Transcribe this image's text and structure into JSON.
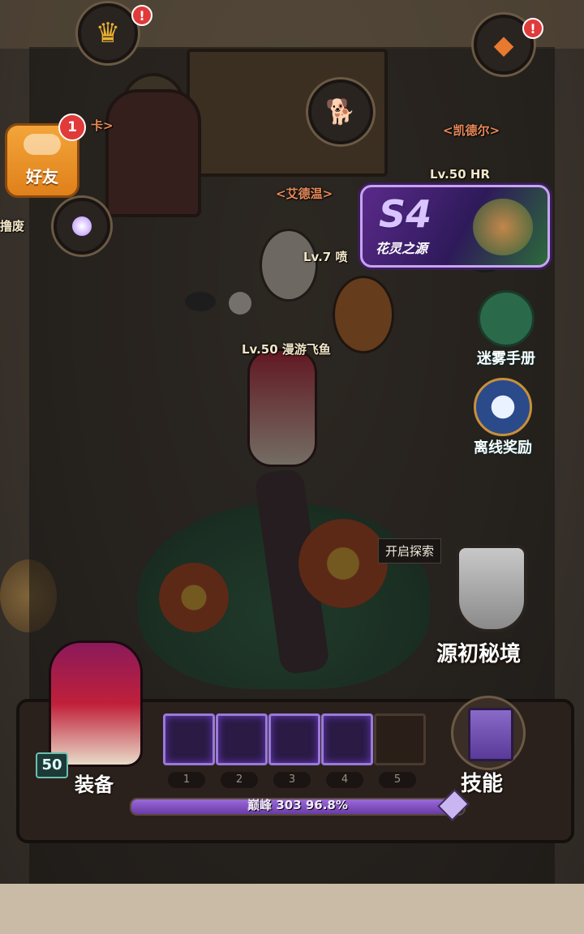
{
  "friends": {
    "label": "好友",
    "badge": "1"
  },
  "npcs": {
    "aiedewen": "<艾德温>",
    "kaideer": "<凯德尔>",
    "left_partial": "卡>",
    "left_partial2": "撸废"
  },
  "players": {
    "lv50_hr": "Lv.50 HR",
    "lv7": "Lv.7 喷",
    "lv50_main": "Lv.50 漫游飞鱼"
  },
  "event": {
    "season": "S4",
    "title": "花灵之源"
  },
  "side_menu": {
    "fog_manual": "迷雾手册",
    "offline_reward": "离线奖励"
  },
  "explore": {
    "tip": "开启探索",
    "realm_label": "源初秘境"
  },
  "bottom": {
    "level": "50",
    "equip_label": "装备",
    "skill_label": "技能",
    "slots": [
      "1",
      "2",
      "3",
      "4",
      "5"
    ],
    "progress_text": "巅峰 303  96.8%",
    "progress_percent": 96.8
  },
  "alerts": {
    "top_left": "!",
    "top_right": "!"
  },
  "colors": {
    "accent_purple": "#9a6ad8",
    "alert_red": "#e03a3a",
    "friend_orange": "#f3a53a"
  }
}
